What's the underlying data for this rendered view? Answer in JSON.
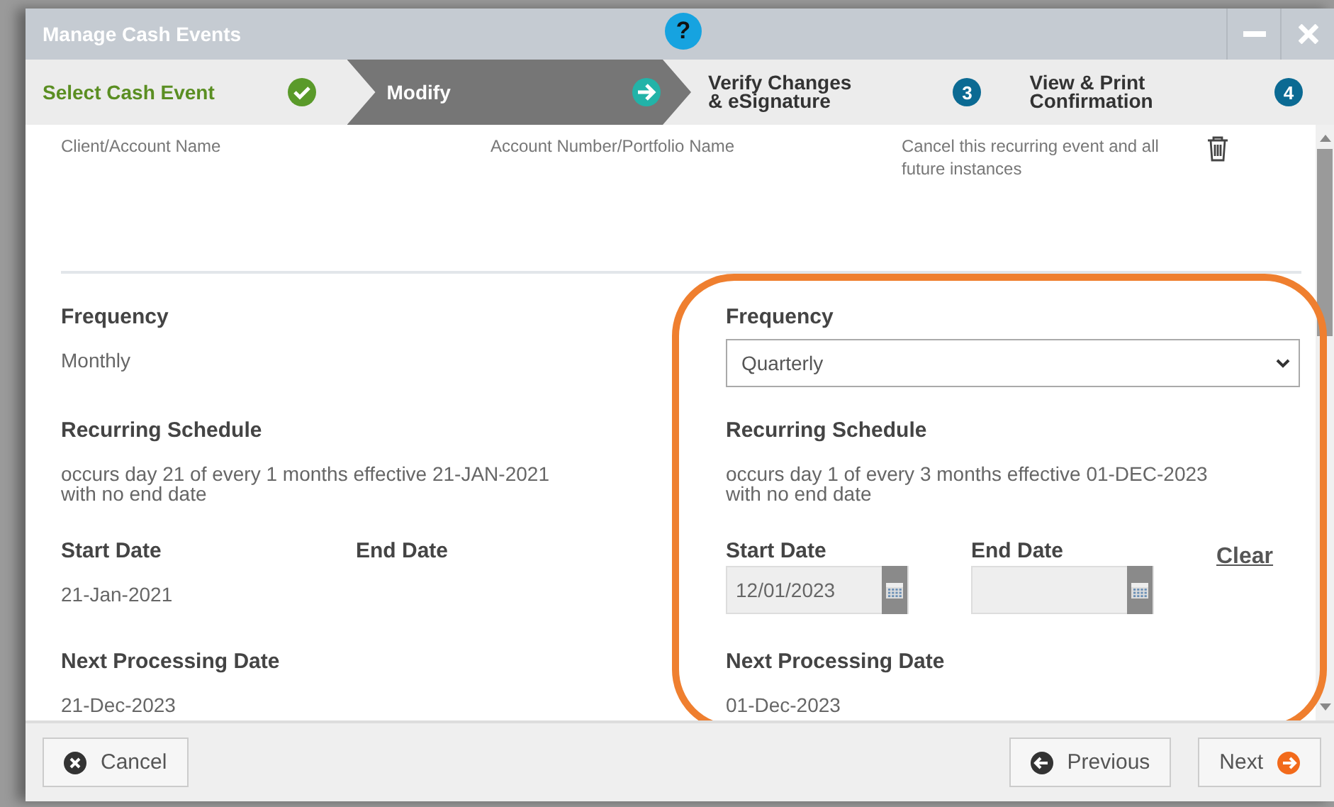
{
  "window": {
    "title": "Manage Cash Events",
    "help": "?"
  },
  "steps": [
    {
      "label_lines": [
        "Select Cash Event"
      ],
      "completed": true,
      "selected": false
    },
    {
      "label_lines": [
        "Modify"
      ],
      "completed": false,
      "selected": true
    },
    {
      "label_lines": [
        "Verify Changes",
        "& eSignature"
      ],
      "completed": false,
      "selected": false,
      "number": "3"
    },
    {
      "label_lines": [
        "View & Print",
        "Confirmation"
      ],
      "completed": false,
      "selected": false,
      "number": "4"
    }
  ],
  "header_columns": [
    "Client/Account Name",
    "Account Number/Portfolio Name",
    "Cancel this recurring event and all future instances"
  ],
  "current": {
    "frequency_label": "Frequency",
    "frequency": "Monthly",
    "schedule_label": "Recurring Schedule",
    "schedule_lines": [
      "occurs day 21 of every 1 months effective 21-JAN-2021",
      "with no end date"
    ],
    "start_label": "Start Date",
    "start": "21-Jan-2021",
    "end_label": "End Date",
    "next_label": "Next Processing Date",
    "next": "21-Dec-2023"
  },
  "modified": {
    "frequency_label": "Frequency",
    "frequency": "Quarterly",
    "schedule_label": "Recurring Schedule",
    "schedule_lines": [
      "occurs day 1 of every 3 months effective 01-DEC-2023",
      "with no end date"
    ],
    "start_label": "Start Date",
    "start": "12/01/2023",
    "end_label": "End Date",
    "clear": "Clear",
    "next_label": "Next Processing Date",
    "next": "01-Dec-2023"
  },
  "footer": {
    "cancel": "Cancel",
    "previous": "Previous",
    "next": "Next"
  }
}
